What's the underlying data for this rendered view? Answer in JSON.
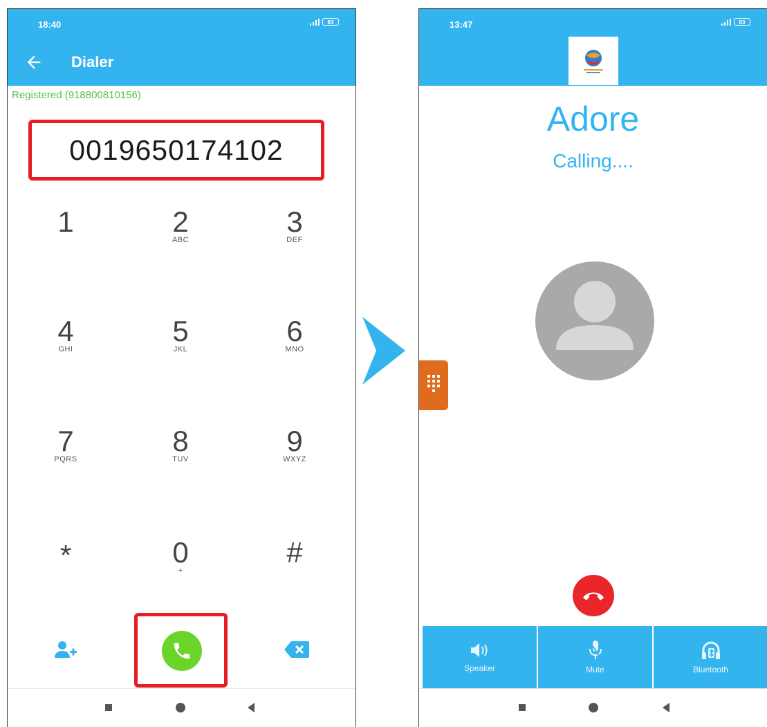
{
  "left_phone": {
    "status": {
      "time": "18:40",
      "battery": "83"
    },
    "app_bar": {
      "title": "Dialer"
    },
    "registered": "Registered (918800810156)",
    "dialed_number": "0019650174102",
    "keys": [
      {
        "digit": "1",
        "letters": ""
      },
      {
        "digit": "2",
        "letters": "ABC"
      },
      {
        "digit": "3",
        "letters": "DEF"
      },
      {
        "digit": "4",
        "letters": "GHI"
      },
      {
        "digit": "5",
        "letters": "JKL"
      },
      {
        "digit": "6",
        "letters": "MNO"
      },
      {
        "digit": "7",
        "letters": "PQRS"
      },
      {
        "digit": "8",
        "letters": "TUV"
      },
      {
        "digit": "9",
        "letters": "WXYZ"
      },
      {
        "digit": "*",
        "letters": ""
      },
      {
        "digit": "0",
        "letters": "+"
      },
      {
        "digit": "#",
        "letters": ""
      }
    ]
  },
  "right_phone": {
    "status": {
      "time": "13:47",
      "battery": "83"
    },
    "caller_name": "Adore",
    "call_status": "Calling....",
    "actions": [
      {
        "label": "Speaker",
        "icon": "speaker-icon"
      },
      {
        "label": "Mute",
        "icon": "microphone-icon"
      },
      {
        "label": "Bluetooth",
        "icon": "bluetooth-headphones-icon"
      }
    ]
  },
  "colors": {
    "primary": "#34b4ee",
    "registered_green": "#5cbf4a",
    "highlight_red": "#e31e24",
    "call_green": "#6ad42b",
    "hangup_red": "#e9262a",
    "keypad_tab_orange": "#e06b1c",
    "avatar_gray": "#a9a9a9"
  }
}
